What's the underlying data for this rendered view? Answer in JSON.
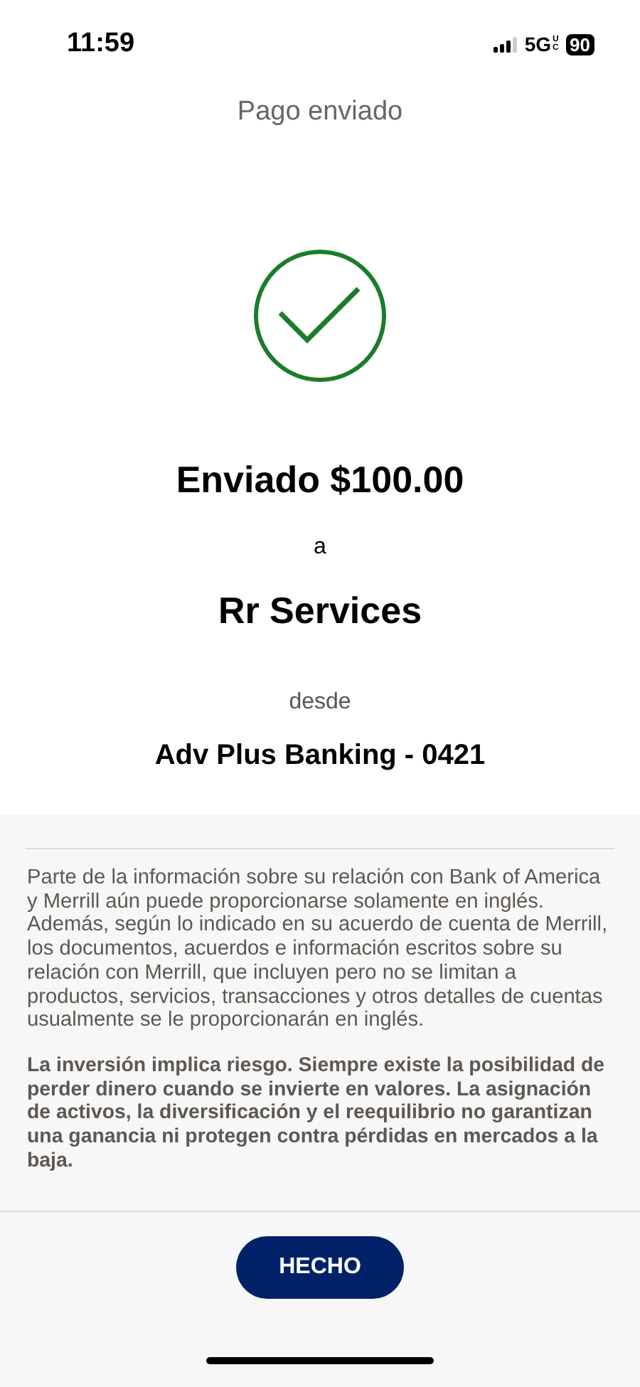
{
  "status_bar": {
    "time": "11:59",
    "network": "5G",
    "network_sub": "UC",
    "battery": "90"
  },
  "header": {
    "title": "Pago enviado"
  },
  "confirmation": {
    "kind": "success",
    "amount_line": "Enviado $100.00",
    "to_word": "a",
    "payee": "Rr Services",
    "from_word": "desde",
    "account": "Adv Plus Banking - 0421"
  },
  "disclosures": [
    {
      "kind": "plain",
      "text": "Parte de la información sobre su relación con Bank of America y Merrill aún puede proporcionarse solamente en inglés. Además, según lo indicado en su acuerdo de cuenta de Merrill, los documentos, acuerdos e información escritos sobre su relación con Merrill, que incluyen pero no se limitan a productos, servicios, transacciones y otros detalles de cuentas usualmente se le proporcionarán en inglés."
    },
    {
      "kind": "bold",
      "text": "La inversión implica riesgo. Siempre existe la posibilidad de perder dinero cuando se invierte en valores. La asignación de activos, la diversificación y el reequilibrio no garantizan una ganancia ni protegen contra pérdidas en mercados a la baja."
    }
  ],
  "buttons": [
    {
      "label": "HECHO"
    }
  ]
}
